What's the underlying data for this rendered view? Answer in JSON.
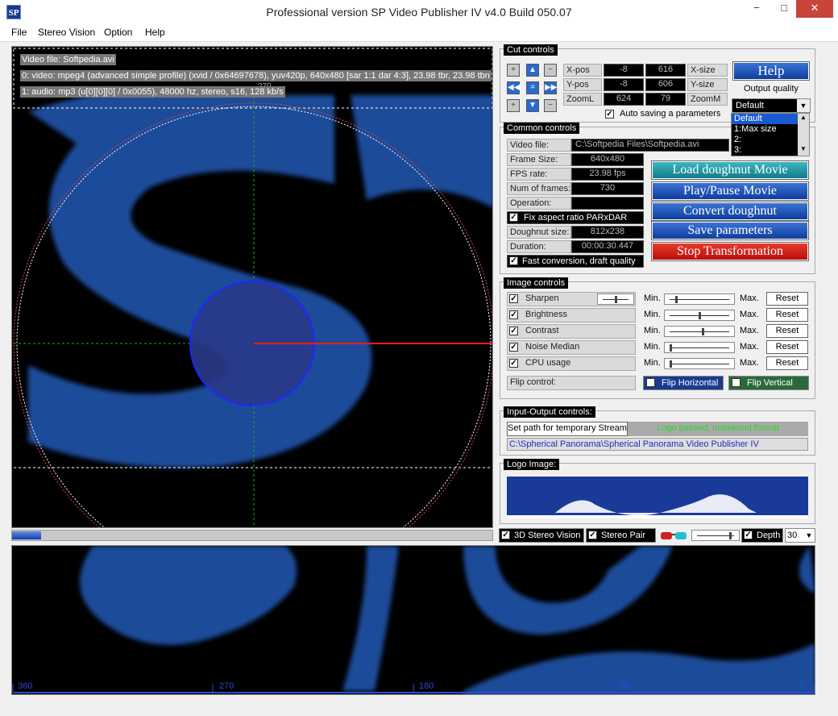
{
  "window": {
    "title": "Professional version SP Video Publisher IV  v4.0 Build 050.07",
    "icon_text": "SP",
    "minimize": "−",
    "maximize": "□",
    "close": "✕"
  },
  "menu": [
    "File",
    "Stereo Vision",
    "Option",
    "Help"
  ],
  "video": {
    "info": [
      "Video file: Softpedia.avi",
      "0: video: mpeg4 (advanced simple profile) (xvid / 0x64697678), yuv420p, 640x480 [sar 1:1 dar 4:3], 23.98 tbr, 23.98 tbn",
      "1: audio: mp3 (u[0][0][0] / 0x0055), 48000 hz, stereo, s16, 128 kb/s"
    ],
    "angle_label": "270",
    "progress": 0.06
  },
  "cut_controls": {
    "title": "Cut controls",
    "xpos_label": "X-pos",
    "xpos_a": "-8",
    "xpos_b": "616",
    "xsize_label": "X-size",
    "ypos_label": "Y-pos",
    "ypos_a": "-8",
    "ypos_b": "606",
    "ysize_label": "Y-size",
    "zoom_label": "ZoomL",
    "zoom_a": "624",
    "zoom_b": "79",
    "zoomm_label": "ZoomM",
    "autosave_label": "Auto saving a parameters",
    "help_label": "Help",
    "output_quality_label": "Output quality",
    "quality_selected": "Default",
    "quality_options": [
      "Default",
      "1:Max size",
      "2:",
      "3:"
    ]
  },
  "common_controls": {
    "title": "Common controls",
    "video_file_label": "Video file:",
    "video_file_value": "C:\\Softpedia Files\\Softpedia.avi",
    "frame_size_label": "Frame Size:",
    "frame_size_value": "640x480",
    "fps_label": "FPS rate:",
    "fps_value": "23.98 fps",
    "frames_label": "Num of frames:",
    "frames_value": "730",
    "operation_label": "Operation:",
    "operation_value": "",
    "fix_aspect_label": "Fix aspect ratio PARxDAR",
    "doughnut_label": "Doughnut size:",
    "doughnut_value": "812x238",
    "duration_label": "Duration:",
    "duration_value": "00:00:30.447",
    "fast_conversion_label": "Fast conversion, draft quality",
    "load_btn": "Load doughnut Movie",
    "play_btn": "Play/Pause Movie",
    "convert_btn": "Convert doughnut",
    "save_btn": "Save parameters",
    "stop_btn": "Stop Transformation"
  },
  "image_controls": {
    "title": "Image controls",
    "min_label": "Min.",
    "max_label": "Max.",
    "reset_label": "Reset",
    "items": [
      {
        "label": "Sharpen",
        "level": 0.1
      },
      {
        "label": "Brightness",
        "level": 0.5
      },
      {
        "label": "Contrast",
        "level": 0.55
      },
      {
        "label": "Noise Median",
        "level": 0.0
      },
      {
        "label": "CPU usage",
        "level": 0.0
      }
    ],
    "sharpen_extra": 0.5,
    "flip_label": "Flip control:",
    "flip_h": "Flip Horizontal",
    "flip_v": "Flip Vertical"
  },
  "io_controls": {
    "title": "Input-Output controls:",
    "set_path_btn": "Set path for temporary Stream",
    "status": "Logo passed, unbekend format",
    "path": "C:\\Spherical Panorama\\Spherical Panorama Video Publisher IV"
  },
  "logo": {
    "title": "Logo Image:"
  },
  "stereo": {
    "stereo_vision_label": "3D Stereo Vision",
    "stereo_pair_label": "Stereo Pair",
    "depth_label": "Depth",
    "depth_value": "30",
    "depth_level": 0.9
  },
  "scale": {
    "ticks": [
      "360",
      "270",
      "180",
      "90",
      "0"
    ]
  },
  "colors": {
    "accent": "#1a4cc8",
    "button_blue": "#0e3c9c",
    "button_red": "#c81010",
    "button_teal": "#1a8a96"
  }
}
